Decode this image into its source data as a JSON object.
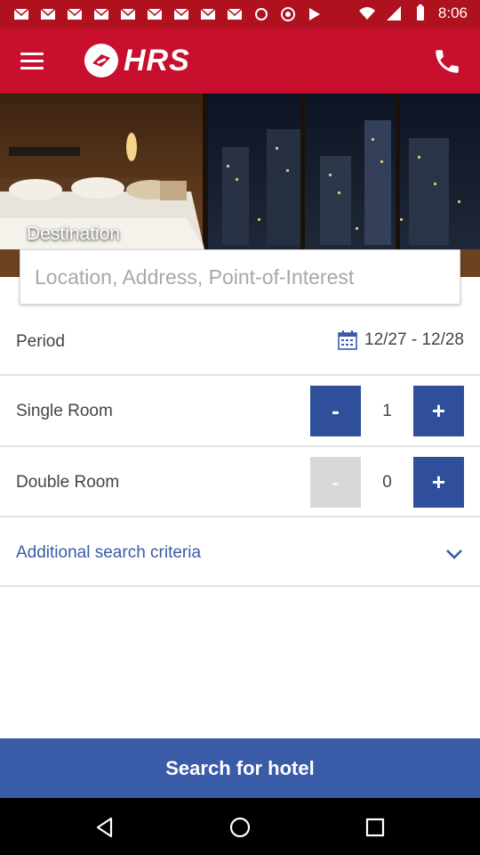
{
  "status_bar": {
    "time": "8:06"
  },
  "app_bar": {
    "logo_text": "HRS"
  },
  "hero": {
    "destination_label": "Destination"
  },
  "location": {
    "placeholder": "Location, Address, Point-of-Interest",
    "value": ""
  },
  "period": {
    "label": "Period",
    "value": "12/27 - 12/28"
  },
  "rooms": {
    "single": {
      "label": "Single Room",
      "count": "1",
      "minus": "-",
      "plus": "+"
    },
    "double": {
      "label": "Double Room",
      "count": "0",
      "minus": "-",
      "plus": "+"
    }
  },
  "criteria": {
    "label": "Additional search criteria"
  },
  "search_button": {
    "label": "Search for hotel"
  },
  "colors": {
    "brand_red": "#c8102e",
    "accent_blue": "#2f4f9b",
    "link_blue": "#3a5ba8"
  },
  "icons": [
    "menu-icon",
    "hrs-logo-icon",
    "phone-icon",
    "calendar-icon",
    "chevron-down-icon",
    "back-icon",
    "home-icon",
    "recents-icon"
  ]
}
